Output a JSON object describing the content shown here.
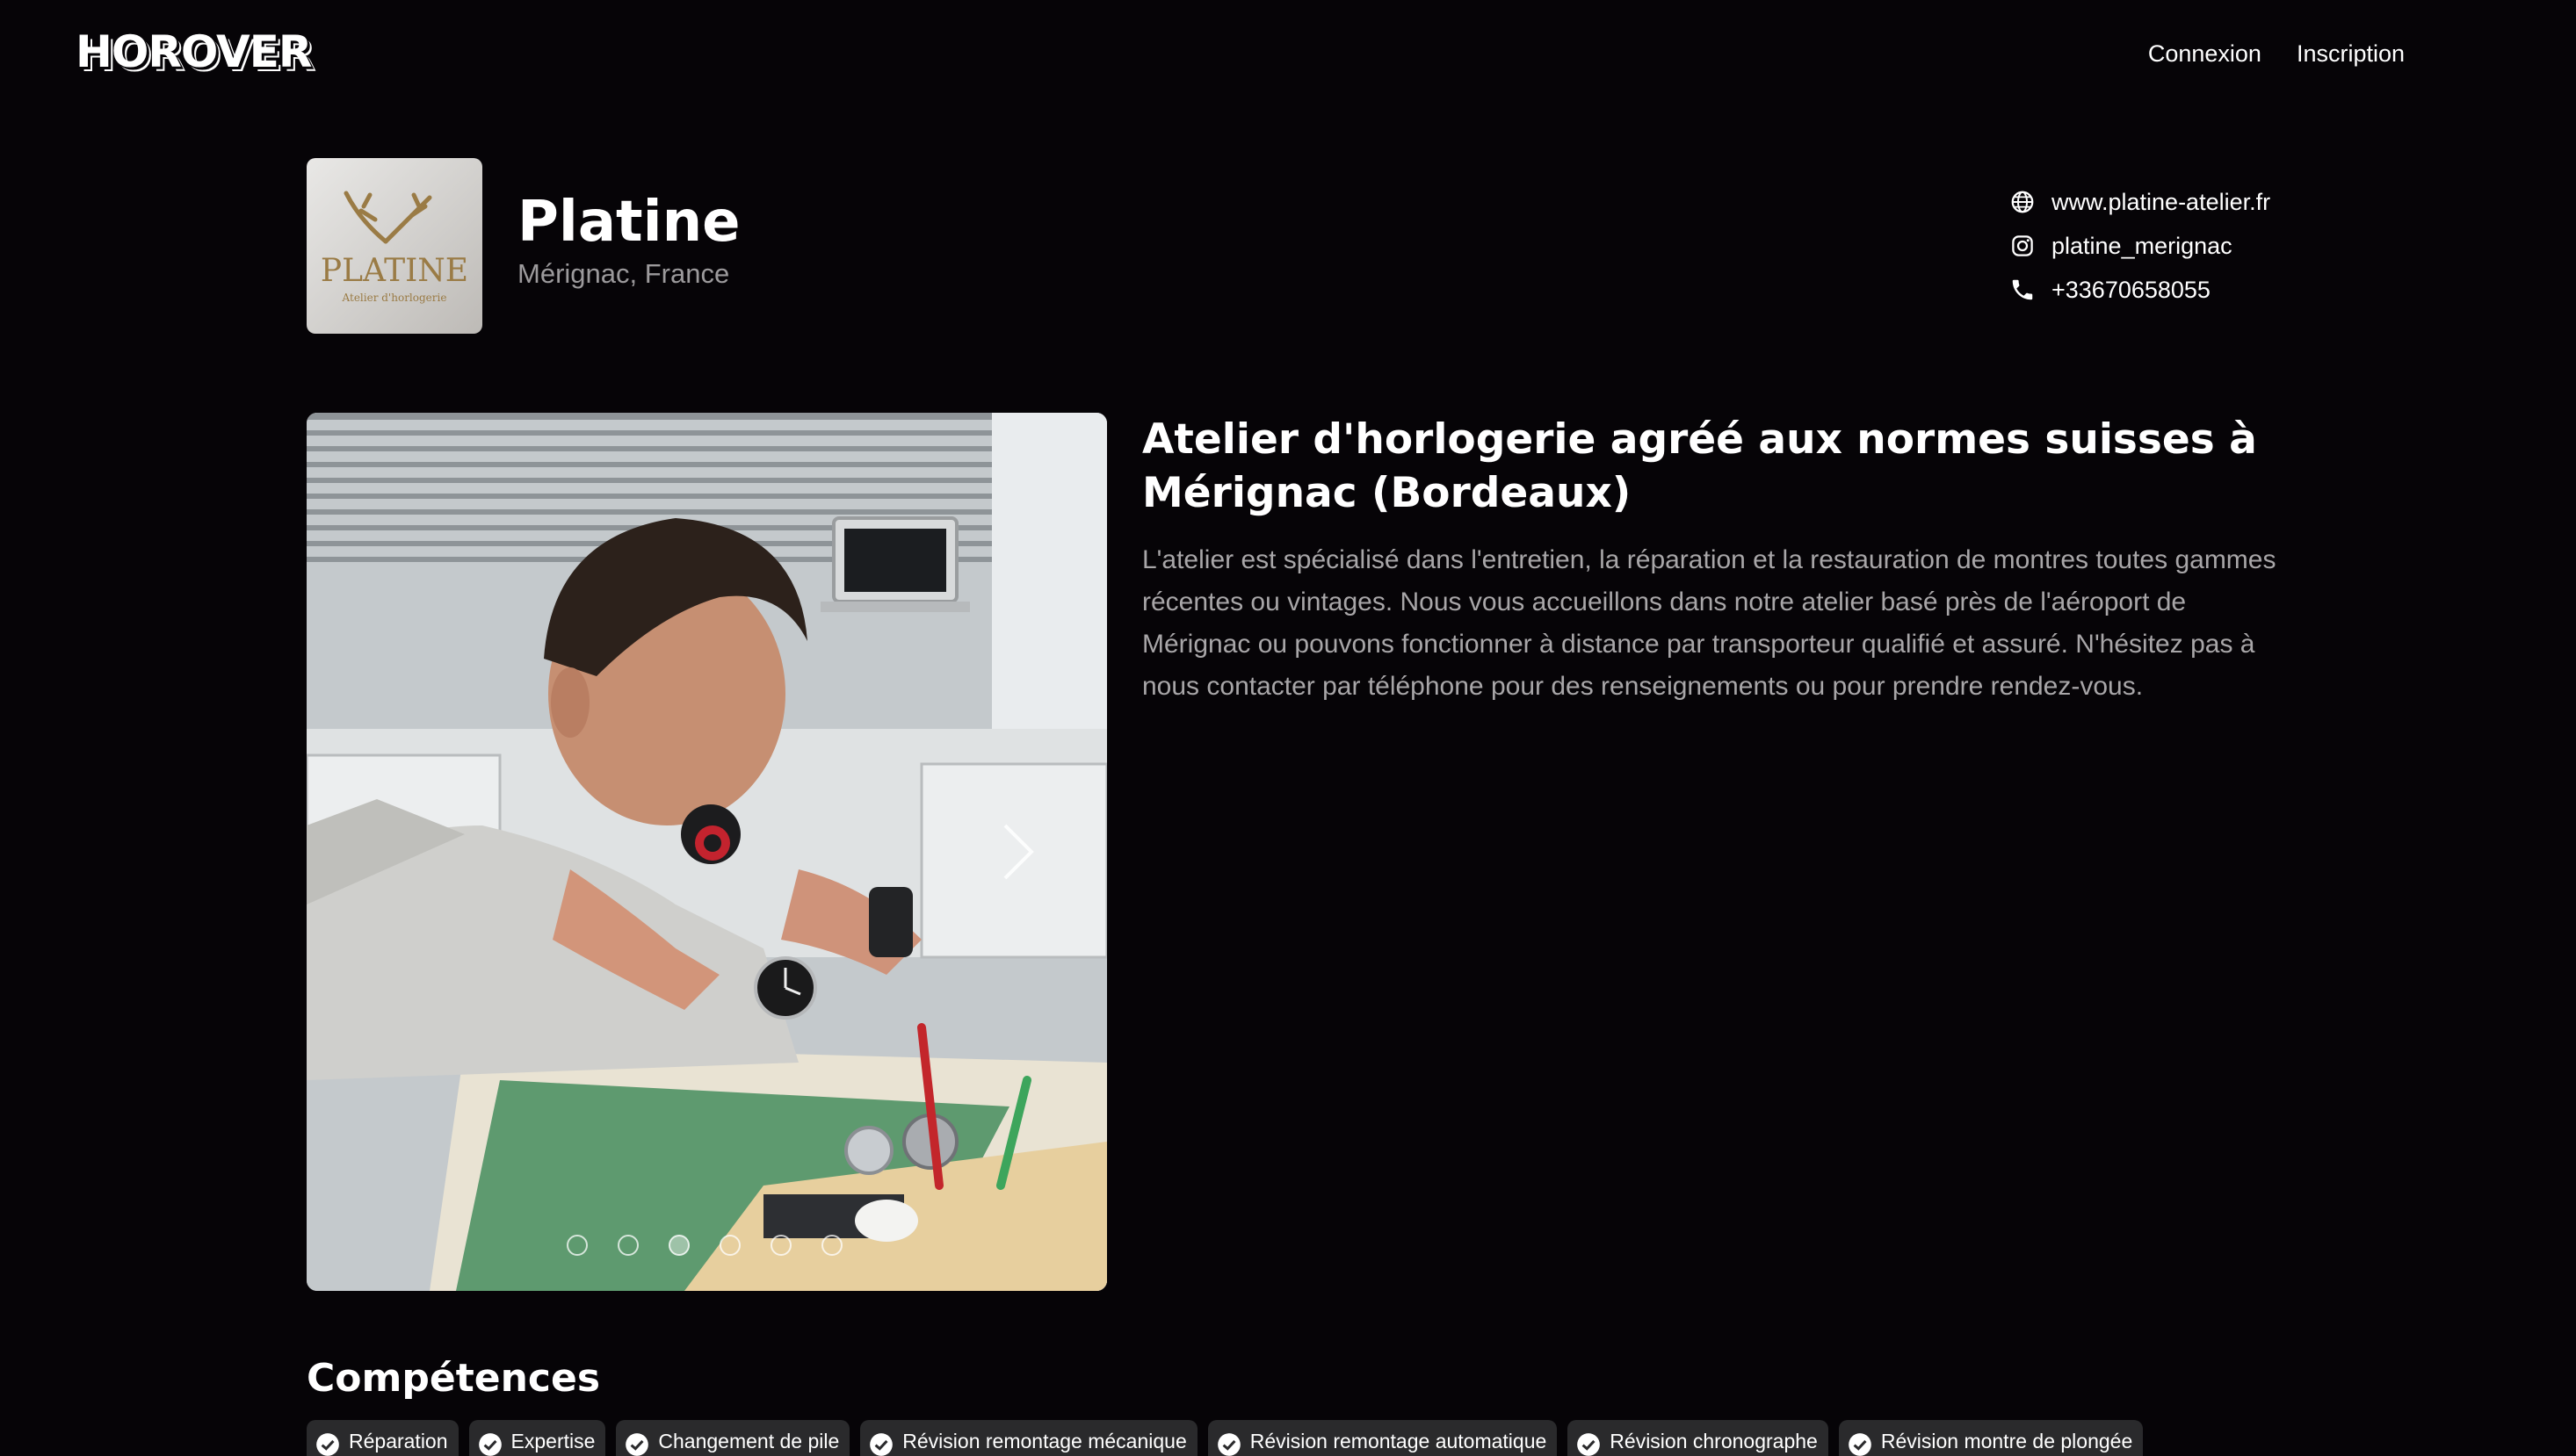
{
  "brand": {
    "logo": "HOROVER"
  },
  "nav": {
    "login": "Connexion",
    "signup": "Inscription"
  },
  "shop": {
    "name": "Platine",
    "location": "Mérignac, France",
    "logo_text": "PLATINE",
    "logo_subtext": "Atelier d'horlogerie"
  },
  "contacts": {
    "website": "www.platine-atelier.fr",
    "instagram": "platine_merignac",
    "phone": "+33670658055"
  },
  "carousel": {
    "slide_count": 6,
    "active_index": 2
  },
  "description": {
    "title": "Atelier d'horlogerie agréé aux normes suisses à Mérignac (Bordeaux)",
    "body": "L'atelier est spécialisé dans l'entretien, la réparation et la restauration de montres toutes gammes récentes ou vintages. Nous vous accueillons dans notre atelier basé près de l'aéroport de Mérignac ou pouvons fonctionner à distance par transporteur qualifié et assuré. N'hésitez pas à nous contacter par téléphone pour des renseignements ou pour prendre rendez-vous."
  },
  "skills": {
    "title": "Compétences",
    "items": [
      "Réparation",
      "Expertise",
      "Changement de pile",
      "Révision remontage mécanique",
      "Révision remontage automatique",
      "Révision chronographe",
      "Révision montre de plongée"
    ]
  },
  "colors": {
    "background": "#060407",
    "muted_text": "#a8a6a8",
    "chip_bg": "#2a2a2c"
  }
}
